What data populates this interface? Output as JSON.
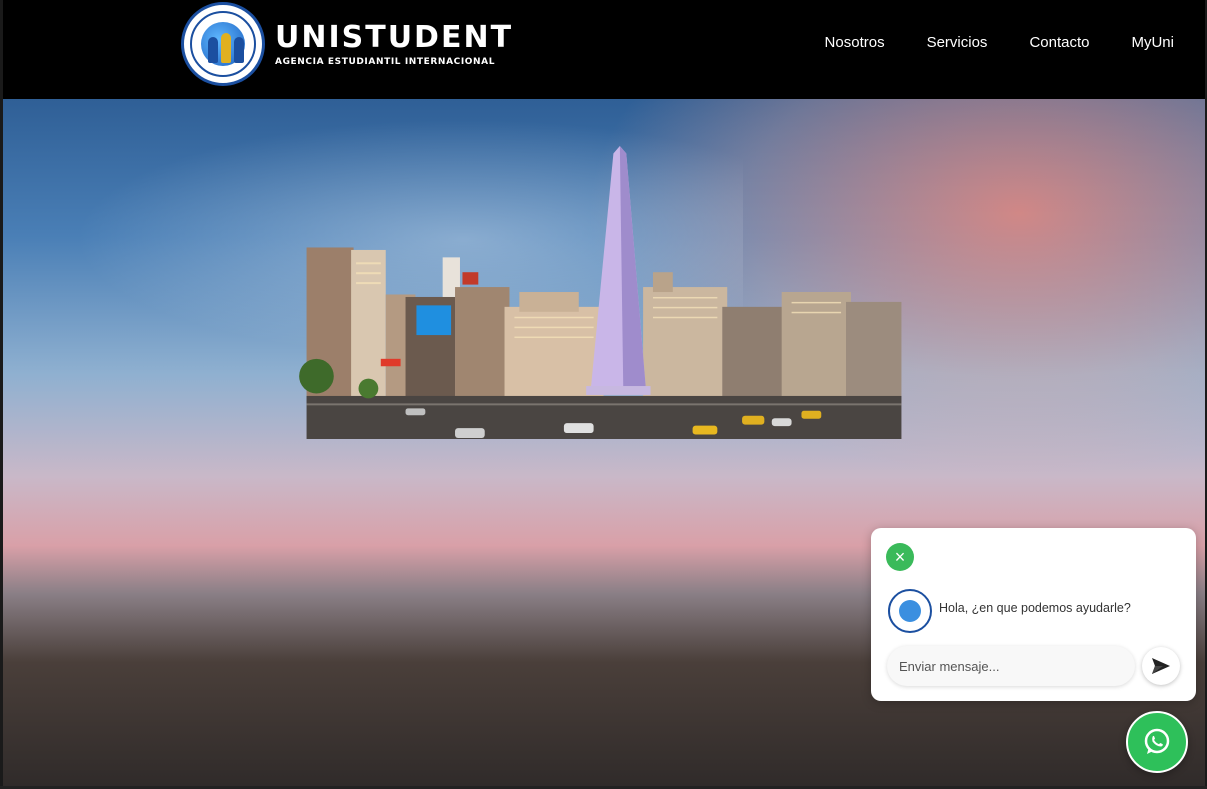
{
  "brand": {
    "title": "UNISTUDENT",
    "subtitle": "AGENCIA ESTUDIANTIL INTERNACIONAL",
    "seal_text": "UNISTUDENT ASESORIA · AGENCIA ESTUDIANTIL INTERNACIONAL",
    "colors": {
      "header_bg": "#000000",
      "seal_blue": "#1b4fa0",
      "whatsapp_green": "#2ec05a"
    }
  },
  "nav": {
    "items": [
      {
        "label": "Nosotros"
      },
      {
        "label": "Servicios"
      },
      {
        "label": "Contacto"
      },
      {
        "label": "MyUni"
      }
    ]
  },
  "hero": {
    "icon": "obelisk-photo"
  },
  "chat": {
    "greeting": "Hola, ¿en que podemos ayudarle?",
    "input_placeholder": "Enviar mensaje...",
    "close_icon": "close-icon",
    "send_icon": "send-icon"
  },
  "whatsapp": {
    "icon": "whatsapp-icon"
  }
}
